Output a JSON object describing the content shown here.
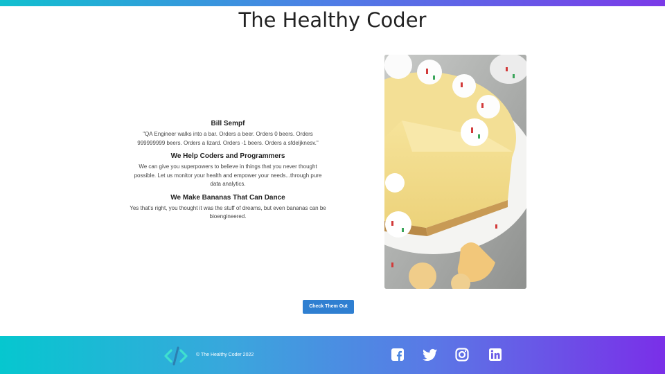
{
  "header": {
    "title": "The Healthy Coder"
  },
  "intro": {
    "sections": [
      {
        "heading": "Bill Sempf",
        "body": "\"QA Engineer walks into a bar. Orders a beer. Orders 0 beers. Orders 999999999 beers. Orders a lizard. Orders -1 beers. Orders a sfdeljknesv.\""
      },
      {
        "heading": "We Help Coders and Programmers",
        "body": "We can give you superpowers to believe in things that you never thought possible. Let us monitor your health and empower your needs...through pure data analytics."
      },
      {
        "heading": "We Make Bananas That Can Dance",
        "body": "Yes that's right, you thought it was the stuff of dreams, but even bananas can be bioengineered."
      }
    ]
  },
  "cta": {
    "label": "Check Them Out"
  },
  "footer": {
    "copyright": "© The Healthy Coder 2022",
    "logo_icon": "code-brackets-logo-icon",
    "social": [
      {
        "name": "facebook",
        "icon": "facebook-icon"
      },
      {
        "name": "twitter",
        "icon": "twitter-icon"
      },
      {
        "name": "instagram",
        "icon": "instagram-icon"
      },
      {
        "name": "linkedin",
        "icon": "linkedin-icon"
      }
    ]
  },
  "colors": {
    "gradient_start": "#11c0cf",
    "gradient_end": "#7b3ae8",
    "button": "#2f7fd1"
  }
}
